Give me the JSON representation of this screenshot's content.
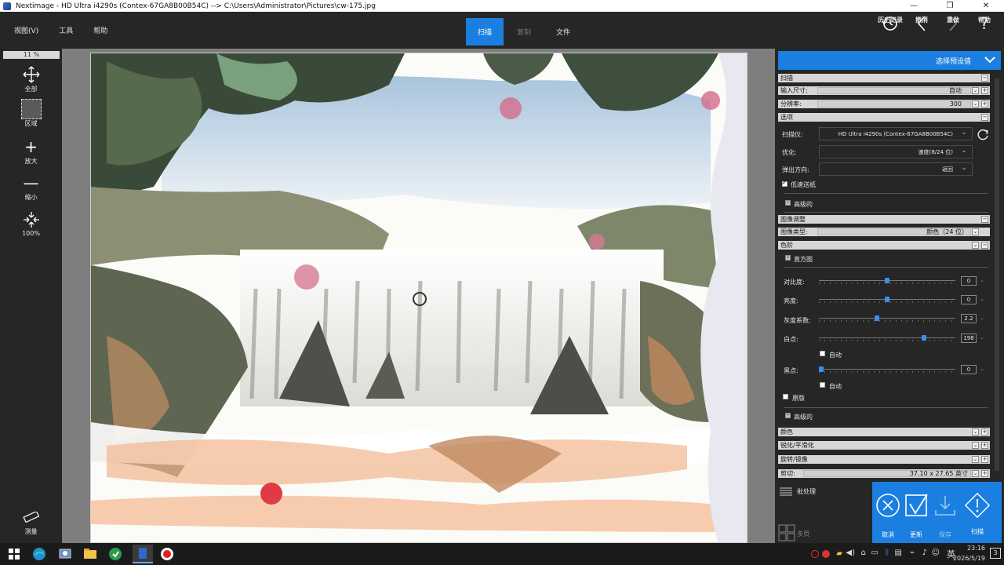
{
  "window": {
    "title": "Nextimage   -  HD Ultra i4290s (Contex-67GA8B00B54C)  -->   C:\\Users\\Administrator\\Pictures\\cw-175.jpg"
  },
  "menu": {
    "view": "视图(V)",
    "tools": "工具",
    "help": "帮助"
  },
  "center_tabs": {
    "scan": "扫描",
    "copy": "复制",
    "file": "文件"
  },
  "toolbar_right": {
    "history": "历史记录",
    "undo": "撤消",
    "redo": "重做",
    "help": "帮助"
  },
  "left_tools": {
    "zoom_percent": "11 %",
    "all": "全部",
    "area": "区域",
    "zoom_in": "放大",
    "zoom_out": "缩小",
    "hundred": "100%",
    "measure": "测量"
  },
  "panel": {
    "preset_label": "选择预设值",
    "scan_section": "扫描",
    "input_size_label": "输入尺寸:",
    "input_size_value": "自动",
    "resolution_label": "分辨率:",
    "resolution_value": "300",
    "options_section": "选项",
    "scanner_label": "扫描仪:",
    "scanner_value": "HD Ultra i4290s (Contex-67GA8B00B54C)",
    "optimize_label": "优化:",
    "optimize_value": "速度(8/24 位)",
    "eject_label": "弹出方向:",
    "eject_value": "返回",
    "slow_feed_label": "低速送纸",
    "advanced_label": "高级的",
    "image_adjust_section": "图像调整",
    "image_type_label": "图像类型:",
    "image_type_value": "颜色（24 位）",
    "levels_section": "色阶",
    "histogram_label": "直方图",
    "contrast_label": "对比度:",
    "contrast_value": "0",
    "brightness_label": "亮度:",
    "brightness_value": "0",
    "gamma_label": "灰度系数:",
    "gamma_value": "2.2",
    "white_point_label": "白点:",
    "white_point_value": "198",
    "auto_label": "自动",
    "black_point_label": "黑点:",
    "black_point_value": "0",
    "original_label": "原版",
    "advanced2_label": "高级的",
    "color_section": "颜色",
    "sharpen_section": "锐化/平滑化",
    "rotate_section": "旋转/镜像",
    "crop_label": "剪切:",
    "crop_value": "37.10 x 27.65 英寸",
    "batch_label": "批处理",
    "multipage_label": "多页"
  },
  "sliders": {
    "contrast": 0.5,
    "brightness": 0.5,
    "gamma": 0.42,
    "white_point": 0.78,
    "black_point": 0.0
  },
  "actions": {
    "cancel": "取消",
    "update": "更新",
    "save": "保存",
    "scan": "扫描"
  },
  "taskbar": {
    "time": "23:16",
    "date": "2026/5/19",
    "lang": "英",
    "notif": "3"
  },
  "colors": {
    "accent": "#1a7fe0",
    "toolbar_bg": "#262626",
    "canvas_bg": "#7e7e7e"
  }
}
